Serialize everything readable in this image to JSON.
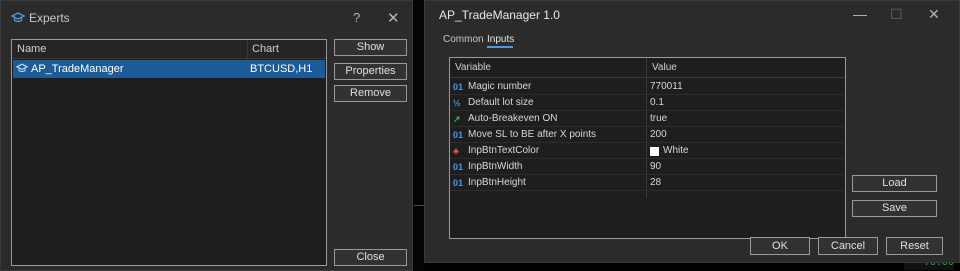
{
  "experts_window": {
    "title": "Experts",
    "help_glyph": "?",
    "close_glyph": "✕",
    "list": {
      "col_name": "Name",
      "col_chart": "Chart",
      "rows": [
        {
          "name": "AP_TradeManager",
          "chart": "BTCUSD,H1"
        }
      ]
    },
    "buttons": {
      "show": "Show",
      "properties": "Properties",
      "remove": "Remove",
      "close": "Close"
    }
  },
  "trade_manager": {
    "title": "AP_TradeManager 1.0",
    "window_controls": {
      "minimize": "—",
      "maximize": "☐",
      "close": "✕"
    },
    "tabs": [
      {
        "label": "Common",
        "active": false
      },
      {
        "label": "Inputs",
        "active": true
      }
    ],
    "grid": {
      "col_variable": "Variable",
      "col_value": "Value",
      "rows": [
        {
          "icon": "int-icon",
          "glyph": "01",
          "name": "Magic number",
          "value": "770011"
        },
        {
          "icon": "double-icon",
          "glyph": "½",
          "name": "Default lot size",
          "value": "0.1"
        },
        {
          "icon": "bool-icon",
          "glyph": "↗",
          "name": "Auto-Breakeven ON",
          "value": "true"
        },
        {
          "icon": "int-icon",
          "glyph": "01",
          "name": "Move SL to BE after X points",
          "value": "200"
        },
        {
          "icon": "color-icon",
          "glyph": "♣",
          "name": "InpBtnTextColor",
          "value": "White",
          "swatch": "#ffffff"
        },
        {
          "icon": "int-icon",
          "glyph": "01",
          "name": "InpBtnWidth",
          "value": "90"
        },
        {
          "icon": "int-icon",
          "glyph": "01",
          "name": "InpBtnHeight",
          "value": "28"
        }
      ]
    },
    "buttons": {
      "load": "Load",
      "save": "Save",
      "ok": "OK",
      "cancel": "Cancel",
      "reset": "Reset"
    }
  },
  "chart_price_label": "70.00",
  "colors": {
    "selection": "#1e5b96",
    "int_icon": "#4a9ae0",
    "double_icon": "#4a9ae0",
    "bool_icon": "#3fb24a",
    "color_icon": "#e05050"
  }
}
